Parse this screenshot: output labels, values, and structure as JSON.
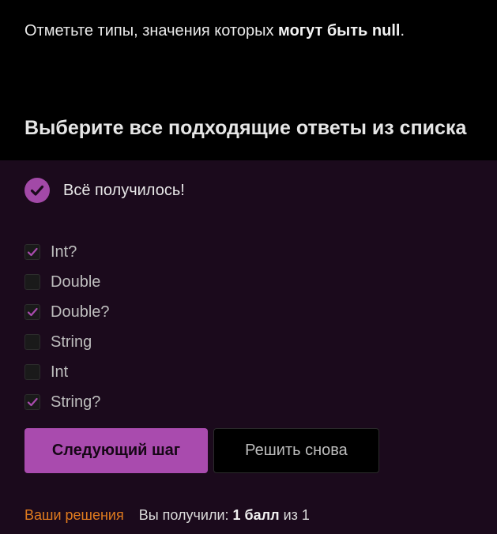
{
  "question": {
    "prefix": "Отметьте типы, значения которых ",
    "emphasis": "могут быть null",
    "suffix": "."
  },
  "heading": "Выберите все подходящие ответы из списка",
  "status": {
    "text": "Всё получилось!",
    "icon": "check-circle-icon",
    "color": "#a249a7"
  },
  "options": [
    {
      "label": "Int?",
      "checked": true
    },
    {
      "label": "Double",
      "checked": false
    },
    {
      "label": "Double?",
      "checked": true
    },
    {
      "label": "String",
      "checked": false
    },
    {
      "label": "Int",
      "checked": false
    },
    {
      "label": "String?",
      "checked": true
    }
  ],
  "buttons": {
    "next_label": "Следующий шаг",
    "retry_label": "Решить снова"
  },
  "footer": {
    "solutions_link": "Ваши решения",
    "score_prefix": "Вы получили: ",
    "score_value": "1 балл",
    "score_suffix": " из 1"
  },
  "colors": {
    "accent": "#a94bae",
    "link": "#e07b1e",
    "answer_background": "#1b0a1c"
  }
}
